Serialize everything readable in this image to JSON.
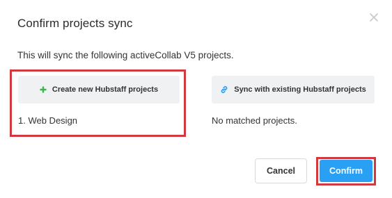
{
  "dialog": {
    "title": "Confirm projects sync",
    "description": "This will sync the following activeCollab V5 projects."
  },
  "options": {
    "create": {
      "label": "Create new Hubstaff projects",
      "icon": "plus-icon",
      "icon_color": "#3ab54a"
    },
    "sync": {
      "label": "Sync with existing Hubstaff projects",
      "icon": "link-icon",
      "icon_color": "#2aa0f5"
    }
  },
  "create_list": {
    "items": [
      "1. Web Design"
    ]
  },
  "sync_list": {
    "empty_text": "No matched projects."
  },
  "footer": {
    "cancel_label": "Cancel",
    "confirm_label": "Confirm"
  },
  "colors": {
    "accent": "#2aa0f5",
    "highlight": "#d0393e"
  }
}
